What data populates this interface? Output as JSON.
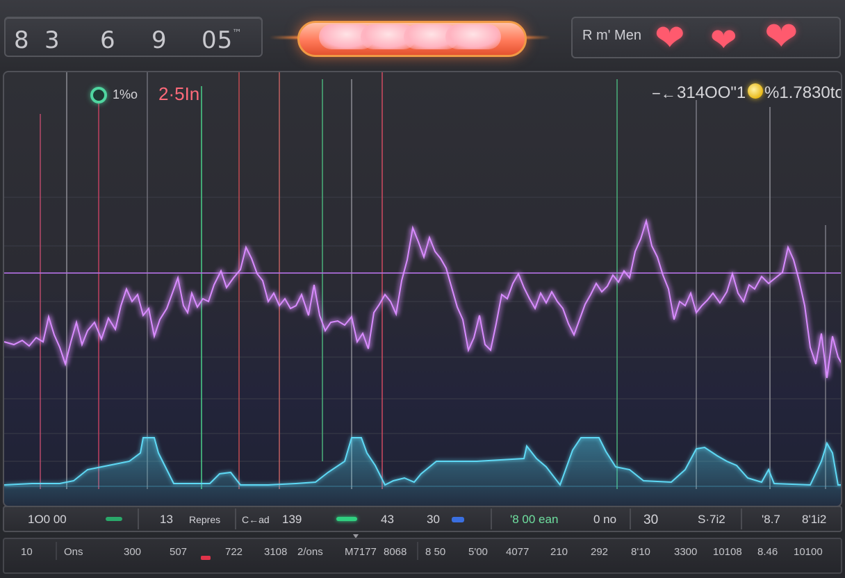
{
  "top_readout": {
    "digits": [
      "8",
      "3",
      "6",
      "9",
      "05",
      "™"
    ]
  },
  "mode_panel": {
    "label": "R m' Men",
    "hearts": [
      "heart",
      "heart",
      "heart"
    ]
  },
  "monitor": {
    "left_indicator": "1%o",
    "left_value": "2·5In",
    "right_prefix": "−←",
    "right_value": "314OO\"1",
    "right_value2": "%1.7830to"
  },
  "readings": [
    {
      "text": "1O0  00"
    },
    {
      "text": "13"
    },
    {
      "text": "Repres"
    },
    {
      "text": "C←ad"
    },
    {
      "text": "139"
    },
    {
      "text": "43"
    },
    {
      "text": "30"
    },
    {
      "text": "'8  00  ean"
    },
    {
      "text": "0  no"
    },
    {
      "text": "30"
    },
    {
      "text": "S·7i2"
    },
    {
      "text": "'8.7"
    },
    {
      "text": "8'1i2"
    }
  ],
  "footer": [
    "10",
    "Ons",
    "300",
    "507",
    "722",
    "3108",
    "2/ons",
    "M7177",
    "8068",
    "8 50",
    "5'00",
    "4077",
    "210",
    "292",
    "8'10",
    "3300",
    "10108",
    "8.46",
    "10100"
  ],
  "colors": {
    "ecg_purple": "#d070ff",
    "pleth_cyan": "#4fd3f0",
    "accent_red": "#e0344a",
    "accent_green": "#4fd6a0"
  }
}
